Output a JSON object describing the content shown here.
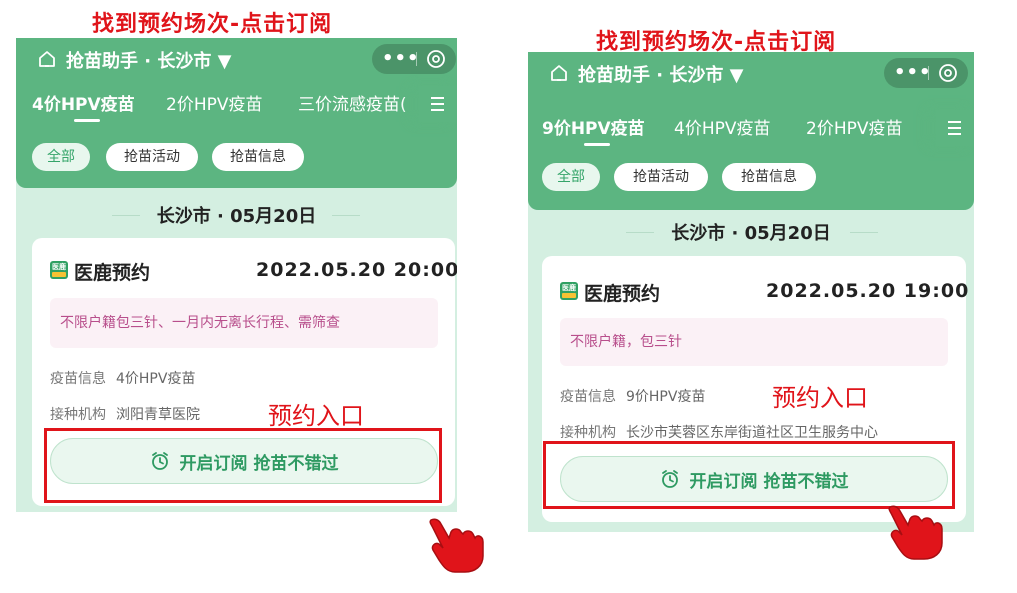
{
  "left": {
    "caption": "找到预约场次-点击订阅",
    "header": {
      "title": "抢苗助手 · 长沙市 ▼",
      "more": "•••",
      "tabs": [
        {
          "label": "4价HPV疫苗",
          "active": true
        },
        {
          "label": "2价HPV疫苗",
          "active": false
        },
        {
          "label": "三价流感疫苗(",
          "active": false
        }
      ],
      "chips": [
        {
          "label": "全部",
          "active": true
        },
        {
          "label": "抢苗活动",
          "active": false
        },
        {
          "label": "抢苗信息",
          "active": false
        }
      ]
    },
    "date": "长沙市 · 05月20日",
    "card": {
      "logo_text": "医鹿",
      "org": "医鹿预约",
      "time": "2022.05.20  20:00",
      "notice": "不限户籍包三针、一月内无离长行程、需筛查",
      "vaccine_label": "疫苗信息",
      "vaccine_value": "4价HPV疫苗",
      "inst_label": "接种机构",
      "inst_value": "浏阳青草医院",
      "subscribe": "开启订阅 抢苗不错过"
    },
    "annotation": "预约入口"
  },
  "right": {
    "caption": "找到预约场次-点击订阅",
    "header": {
      "title": "抢苗助手 · 长沙市 ▼",
      "more": "•••",
      "tabs": [
        {
          "label": "9价HPV疫苗",
          "active": true
        },
        {
          "label": "4价HPV疫苗",
          "active": false
        },
        {
          "label": "2价HPV疫苗",
          "active": false
        }
      ],
      "chips": [
        {
          "label": "全部",
          "active": true
        },
        {
          "label": "抢苗活动",
          "active": false
        },
        {
          "label": "抢苗信息",
          "active": false
        }
      ]
    },
    "date": "长沙市 · 05月20日",
    "card": {
      "logo_text": "医鹿",
      "org": "医鹿预约",
      "time": "2022.05.20  19:00",
      "notice": "不限户籍，包三针",
      "vaccine_label": "疫苗信息",
      "vaccine_value": "9价HPV疫苗",
      "inst_label": "接种机构",
      "inst_value": "长沙市芙蓉区东岸街道社区卫生服务中心",
      "subscribe": "开启订阅 抢苗不错过"
    },
    "annotation": "预约入口"
  },
  "colors": {
    "header_green": "#5cb581",
    "panel_bg": "#d4efe1",
    "accent_red": "#e0141a",
    "button_text": "#2e9a62",
    "notice_text": "#b84f8c"
  },
  "icons": [
    "home-icon",
    "more-icon",
    "close-circle-icon",
    "menu-icon",
    "alarm-clock-icon",
    "pointing-hand-icon"
  ]
}
